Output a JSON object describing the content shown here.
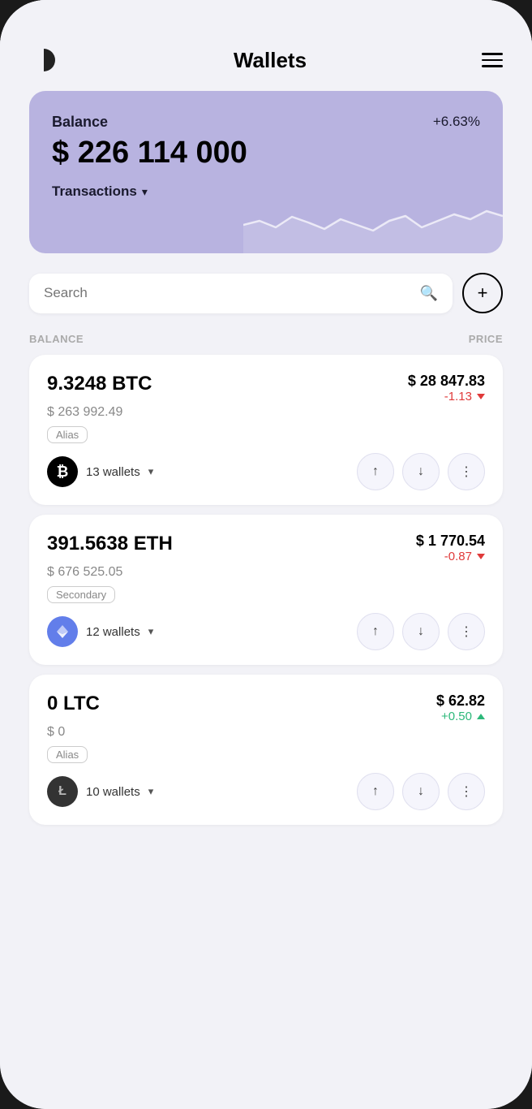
{
  "app": {
    "title": "Wallets"
  },
  "header": {
    "logo_alt": "logo",
    "menu_alt": "menu"
  },
  "balance_card": {
    "label": "Balance",
    "amount": "$ 226 114 000",
    "percent": "+6.63%",
    "transactions_label": "Transactions"
  },
  "search": {
    "placeholder": "Search",
    "add_button_label": "+"
  },
  "columns": {
    "balance": "BALANCE",
    "price": "PRICE"
  },
  "coins": [
    {
      "id": "btc",
      "amount": "9.3248 BTC",
      "usd_value": "$ 263 992.49",
      "price": "$ 28 847.83",
      "change": "-1.13",
      "change_type": "negative",
      "alias": "Alias",
      "wallets_count": "13 wallets",
      "symbol": "₿"
    },
    {
      "id": "eth",
      "amount": "391.5638 ETH",
      "usd_value": "$ 676 525.05",
      "price": "$ 1 770.54",
      "change": "-0.87",
      "change_type": "negative",
      "alias": "Secondary",
      "wallets_count": "12 wallets",
      "symbol": "⟠"
    },
    {
      "id": "ltc",
      "amount": "0 LTC",
      "usd_value": "$ 0",
      "price": "$ 62.82",
      "change": "+0.50",
      "change_type": "positive",
      "alias": "Alias",
      "wallets_count": "10 wallets",
      "symbol": "Ł"
    }
  ],
  "actions": {
    "send_label": "↑",
    "receive_label": "↓",
    "more_label": "⋮"
  }
}
